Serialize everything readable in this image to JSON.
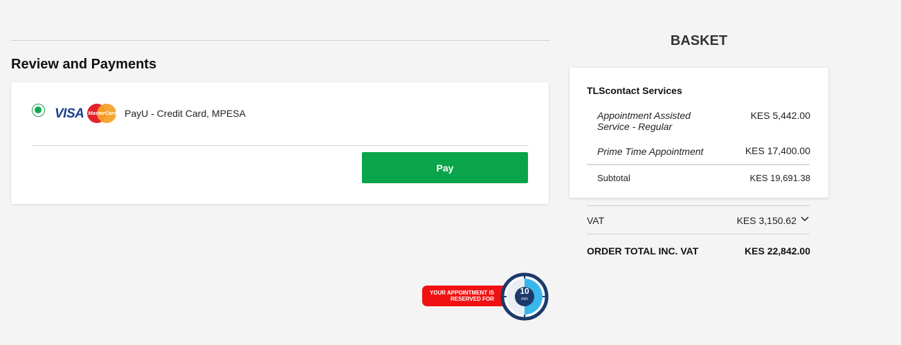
{
  "review": {
    "title": "Review and Payments",
    "payment_method": {
      "label": "PayU - Credit Card, MPESA",
      "selected": true,
      "logos": [
        "visa-logo",
        "mastercard-logo"
      ],
      "visa_text": "VISA",
      "mastercard_text": "MasterCard"
    },
    "pay_button": "Pay"
  },
  "basket": {
    "title": "BASKET",
    "services_title": "TLScontact Services",
    "items": [
      {
        "name": "Appointment Assisted Service - Regular",
        "price": "KES 5,442.00"
      },
      {
        "name": "Prime Time Appointment",
        "price": "KES 17,400.00"
      }
    ],
    "subtotal_label": "Subtotal",
    "subtotal_value": "KES 19,691.38",
    "vat_label": "VAT",
    "vat_value": "KES 3,150.62",
    "total_label": "ORDER TOTAL INC. VAT",
    "total_value": "KES 22,842.00"
  },
  "reservation": {
    "text_line1": "YOUR APPOINTMENT IS",
    "text_line2": "RESERVED FOR",
    "minutes": "10",
    "unit": "min"
  },
  "colors": {
    "pay_green": "#0aa54a",
    "radio_green": "#14a84d",
    "reserve_red": "#f01212",
    "timer_navy": "#1b3a6b",
    "timer_blue": "#3ab7ea"
  }
}
